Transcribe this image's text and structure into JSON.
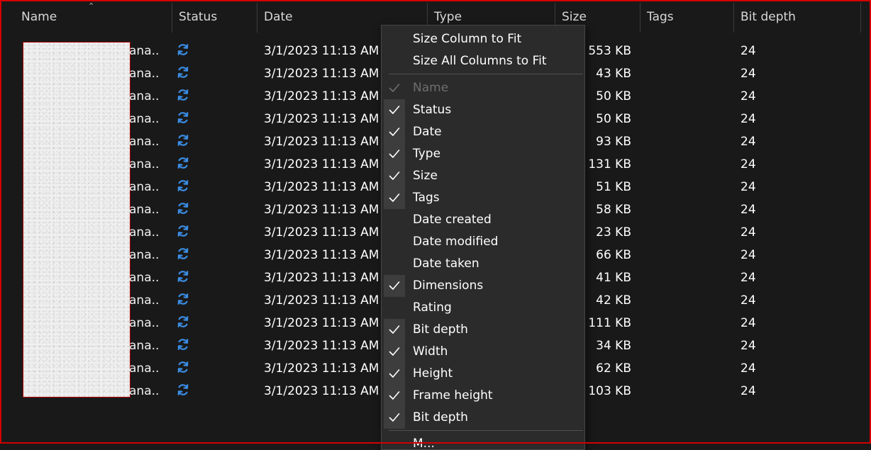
{
  "columns": {
    "name": "Name",
    "status": "Status",
    "date": "Date",
    "type": "Type",
    "size": "Size",
    "tags": "Tags",
    "bit_depth": "Bit depth"
  },
  "rows": [
    {
      "name": "ana...",
      "status_icon": "sync-icon",
      "date": "3/1/2023 11:13 AM",
      "size": "553 KB",
      "bit_depth": "24"
    },
    {
      "name": "ana...",
      "status_icon": "sync-icon",
      "date": "3/1/2023 11:13 AM",
      "size": "43 KB",
      "bit_depth": "24"
    },
    {
      "name": "ana...",
      "status_icon": "sync-icon",
      "date": "3/1/2023 11:13 AM",
      "size": "50 KB",
      "bit_depth": "24"
    },
    {
      "name": "ana...",
      "status_icon": "sync-icon",
      "date": "3/1/2023 11:13 AM",
      "size": "50 KB",
      "bit_depth": "24"
    },
    {
      "name": "ana...",
      "status_icon": "sync-icon",
      "date": "3/1/2023 11:13 AM",
      "size": "93 KB",
      "bit_depth": "24"
    },
    {
      "name": "ana...",
      "status_icon": "sync-icon",
      "date": "3/1/2023 11:13 AM",
      "size": "131 KB",
      "bit_depth": "24"
    },
    {
      "name": "ana...",
      "status_icon": "sync-icon",
      "date": "3/1/2023 11:13 AM",
      "size": "51 KB",
      "bit_depth": "24"
    },
    {
      "name": "ana...",
      "status_icon": "sync-icon",
      "date": "3/1/2023 11:13 AM",
      "size": "58 KB",
      "bit_depth": "24"
    },
    {
      "name": "ana...",
      "status_icon": "sync-icon",
      "date": "3/1/2023 11:13 AM",
      "size": "23 KB",
      "bit_depth": "24"
    },
    {
      "name": "ana...",
      "status_icon": "sync-icon",
      "date": "3/1/2023 11:13 AM",
      "size": "66 KB",
      "bit_depth": "24"
    },
    {
      "name": "ana...",
      "status_icon": "sync-icon",
      "date": "3/1/2023 11:13 AM",
      "size": "41 KB",
      "bit_depth": "24"
    },
    {
      "name": "ana...",
      "status_icon": "sync-icon",
      "date": "3/1/2023 11:13 AM",
      "size": "42 KB",
      "bit_depth": "24"
    },
    {
      "name": "ana...",
      "status_icon": "sync-icon",
      "date": "3/1/2023 11:13 AM",
      "size": "111 KB",
      "bit_depth": "24"
    },
    {
      "name": "ana...",
      "status_icon": "sync-icon",
      "date": "3/1/2023 11:13 AM",
      "size": "34 KB",
      "bit_depth": "24"
    },
    {
      "name": "ana...",
      "status_icon": "sync-icon",
      "date": "3/1/2023 11:13 AM",
      "size": "62 KB",
      "bit_depth": "24"
    },
    {
      "name": "ana...",
      "status_icon": "sync-icon",
      "date": "3/1/2023 11:13 AM",
      "size": "103 KB",
      "bit_depth": "24"
    }
  ],
  "context_menu": {
    "size_column_to_fit": "Size Column to Fit",
    "size_all_columns_to_fit": "Size All Columns to Fit",
    "items": [
      {
        "label": "Name",
        "checked": true,
        "disabled": true
      },
      {
        "label": "Status",
        "checked": true,
        "disabled": false
      },
      {
        "label": "Date",
        "checked": true,
        "disabled": false
      },
      {
        "label": "Type",
        "checked": true,
        "disabled": false
      },
      {
        "label": "Size",
        "checked": true,
        "disabled": false
      },
      {
        "label": "Tags",
        "checked": true,
        "disabled": false
      },
      {
        "label": "Date created",
        "checked": false,
        "disabled": false
      },
      {
        "label": "Date modified",
        "checked": false,
        "disabled": false
      },
      {
        "label": "Date taken",
        "checked": false,
        "disabled": false
      },
      {
        "label": "Dimensions",
        "checked": true,
        "disabled": false
      },
      {
        "label": "Rating",
        "checked": false,
        "disabled": false
      },
      {
        "label": "Bit depth",
        "checked": true,
        "disabled": false
      },
      {
        "label": "Width",
        "checked": true,
        "disabled": false
      },
      {
        "label": "Height",
        "checked": true,
        "disabled": false
      },
      {
        "label": "Frame height",
        "checked": true,
        "disabled": false
      },
      {
        "label": "Bit depth",
        "checked": true,
        "disabled": false
      }
    ],
    "more_label": "M..."
  },
  "colors": {
    "background": "#191919",
    "menu_background": "#2b2b2b",
    "sync_icon": "#3a8ee6",
    "frame_border": "#d40000"
  }
}
